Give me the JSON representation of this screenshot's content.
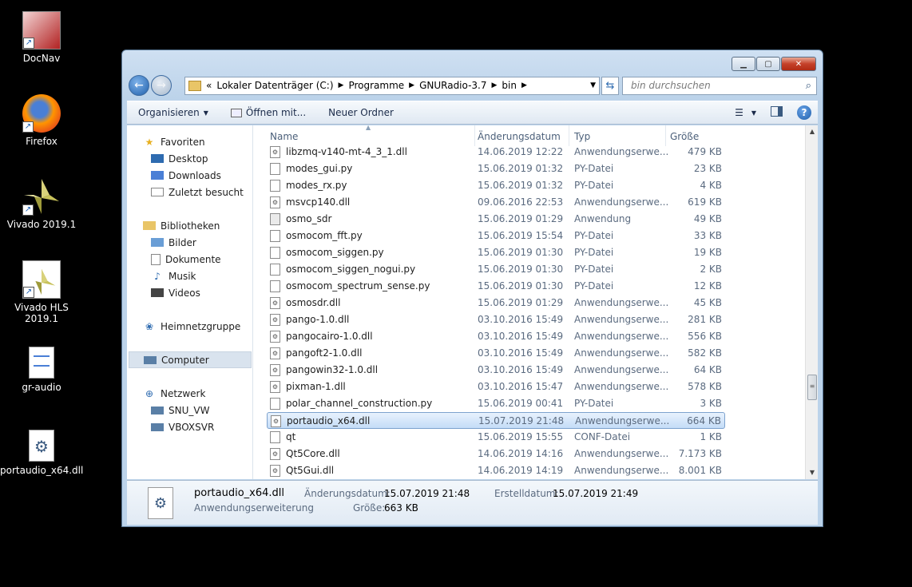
{
  "desktop": {
    "icons": [
      {
        "label": "DocNav",
        "icon": "docnav-icon"
      },
      {
        "label": "Firefox",
        "icon": "firefox-icon"
      },
      {
        "label": "Vivado 2019.1",
        "icon": "vivado-icon"
      },
      {
        "label": "Vivado HLS 2019.1",
        "icon": "vivado-hls-icon"
      },
      {
        "label": "gr-audio",
        "icon": "document-icon"
      },
      {
        "label": "portaudio_x64.dll",
        "icon": "dll-icon"
      }
    ]
  },
  "window": {
    "address": {
      "chevron": "«",
      "crumbs": [
        "Lokaler Datenträger (C:)",
        "Programme",
        "GNURadio-3.7",
        "bin"
      ]
    },
    "search_placeholder": "bin durchsuchen",
    "toolbar": {
      "organize": "Organisieren",
      "open_with": "Öffnen mit...",
      "new_folder": "Neuer Ordner"
    },
    "nav": {
      "favorites": "Favoriten",
      "desktop": "Desktop",
      "downloads": "Downloads",
      "recent": "Zuletzt besucht",
      "libraries": "Bibliotheken",
      "pictures": "Bilder",
      "documents": "Dokumente",
      "music": "Musik",
      "videos": "Videos",
      "homegroup": "Heimnetzgruppe",
      "computer": "Computer",
      "network": "Netzwerk",
      "net1": "SNU_VW",
      "net2": "VBOXSVR"
    },
    "columns": {
      "name": "Name",
      "date": "Änderungsdatum",
      "type": "Typ",
      "size": "Größe"
    },
    "files": [
      {
        "name": "libzmq-v140-mt-4_3_1.dll",
        "date": "14.06.2019 12:22",
        "type": "Anwendungserwe...",
        "size": "479 KB"
      },
      {
        "name": "modes_gui.py",
        "date": "15.06.2019 01:32",
        "type": "PY-Datei",
        "size": "23 KB"
      },
      {
        "name": "modes_rx.py",
        "date": "15.06.2019 01:32",
        "type": "PY-Datei",
        "size": "4 KB"
      },
      {
        "name": "msvcp140.dll",
        "date": "09.06.2016 22:53",
        "type": "Anwendungserwe...",
        "size": "619 KB"
      },
      {
        "name": "osmo_sdr",
        "date": "15.06.2019 01:29",
        "type": "Anwendung",
        "size": "49 KB"
      },
      {
        "name": "osmocom_fft.py",
        "date": "15.06.2019 15:54",
        "type": "PY-Datei",
        "size": "33 KB"
      },
      {
        "name": "osmocom_siggen.py",
        "date": "15.06.2019 01:30",
        "type": "PY-Datei",
        "size": "19 KB"
      },
      {
        "name": "osmocom_siggen_nogui.py",
        "date": "15.06.2019 01:30",
        "type": "PY-Datei",
        "size": "2 KB"
      },
      {
        "name": "osmocom_spectrum_sense.py",
        "date": "15.06.2019 01:30",
        "type": "PY-Datei",
        "size": "12 KB"
      },
      {
        "name": "osmosdr.dll",
        "date": "15.06.2019 01:29",
        "type": "Anwendungserwe...",
        "size": "45 KB"
      },
      {
        "name": "pango-1.0.dll",
        "date": "03.10.2016 15:49",
        "type": "Anwendungserwe...",
        "size": "281 KB"
      },
      {
        "name": "pangocairo-1.0.dll",
        "date": "03.10.2016 15:49",
        "type": "Anwendungserwe...",
        "size": "556 KB"
      },
      {
        "name": "pangoft2-1.0.dll",
        "date": "03.10.2016 15:49",
        "type": "Anwendungserwe...",
        "size": "582 KB"
      },
      {
        "name": "pangowin32-1.0.dll",
        "date": "03.10.2016 15:49",
        "type": "Anwendungserwe...",
        "size": "64 KB"
      },
      {
        "name": "pixman-1.dll",
        "date": "03.10.2016 15:47",
        "type": "Anwendungserwe...",
        "size": "578 KB"
      },
      {
        "name": "polar_channel_construction.py",
        "date": "15.06.2019 00:41",
        "type": "PY-Datei",
        "size": "3 KB"
      },
      {
        "name": "portaudio_x64.dll",
        "date": "15.07.2019 21:48",
        "type": "Anwendungserwe...",
        "size": "664 KB"
      },
      {
        "name": "qt",
        "date": "15.06.2019 15:55",
        "type": "CONF-Datei",
        "size": "1 KB"
      },
      {
        "name": "Qt5Core.dll",
        "date": "14.06.2019 14:16",
        "type": "Anwendungserwe...",
        "size": "7.173 KB"
      },
      {
        "name": "Qt5Gui.dll",
        "date": "14.06.2019 14:19",
        "type": "Anwendungserwe...",
        "size": "8.001 KB"
      }
    ],
    "details": {
      "filename": "portaudio_x64.dll",
      "kind": "Anwendungserweiterung",
      "modified_label": "Änderungsdatum:",
      "modified_value": "15.07.2019 21:48",
      "created_label": "Erstelldatum:",
      "created_value": "15.07.2019 21:49",
      "size_label": "Größe:",
      "size_value": "663 KB"
    }
  }
}
